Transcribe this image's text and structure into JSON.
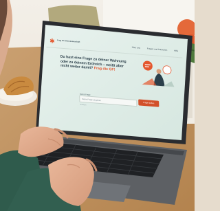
{
  "screen": {
    "logo_text": "Frag die Genossenschaft",
    "nav": [
      "Über uns",
      "Fragen und Antworten",
      "Hilfe"
    ],
    "headline_lines": [
      "Du hast eine Frage zu deiner Wohnung",
      "oder zu deinem Erdreich – weißt aber",
      "nicht weiter damit?"
    ],
    "headline_accent": "Frag die GF!",
    "form_label": "Deine Frage",
    "input_placeholder": "Deine Frage eingeben",
    "submit_label": "Frage stellen",
    "status_text": "Anonym"
  },
  "colors": {
    "accent": "#e4572e",
    "screen_background": "#dfece6",
    "heading": "#2b3f4a"
  }
}
